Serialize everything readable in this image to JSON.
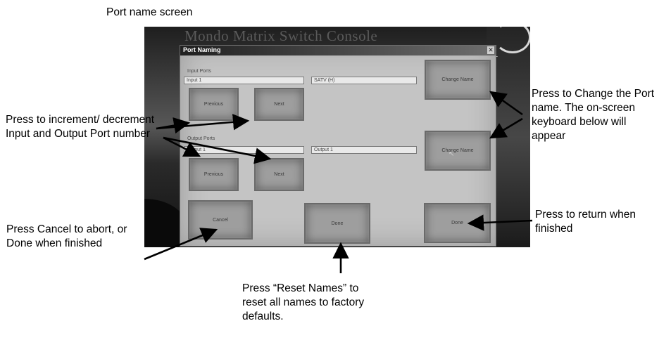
{
  "figure": {
    "caption_title": "Port name screen"
  },
  "console_background": {
    "title": "Mondo Matrix Switch Console",
    "strip_mark": "1"
  },
  "dialog": {
    "title": "Port Naming",
    "close_icon": "close-icon",
    "input_ports": {
      "label": "Input Ports",
      "current_port": "Input 1",
      "name_value": "SATV (H)",
      "previous_label": "Previous",
      "next_label": "Next",
      "change_name_label": "Change Name"
    },
    "output_ports": {
      "label": "Output Ports",
      "current_port": "Output 1",
      "name_value": "Output 1",
      "previous_label": "Previous",
      "next_label": "Next",
      "change_name_label": "Change Name"
    },
    "cancel_label": "Cancel",
    "reset_names_label": "Done",
    "done_label": "Done"
  },
  "annotations": {
    "increment": "Press to increment/ decrement Input and Output Port number",
    "change_name": "Press to Change the Port name. The on-screen keyboard below will appear",
    "cancel_done": "Press Cancel to abort, or Done when finished",
    "reset_names": "Press “Reset Names” to reset all names to factory defaults.",
    "return": "Press to return when finished"
  },
  "colors": {
    "dialog_face": "#c4c4c4",
    "button_face": "#9e9e9e",
    "titlebar_dark": "#202020"
  }
}
